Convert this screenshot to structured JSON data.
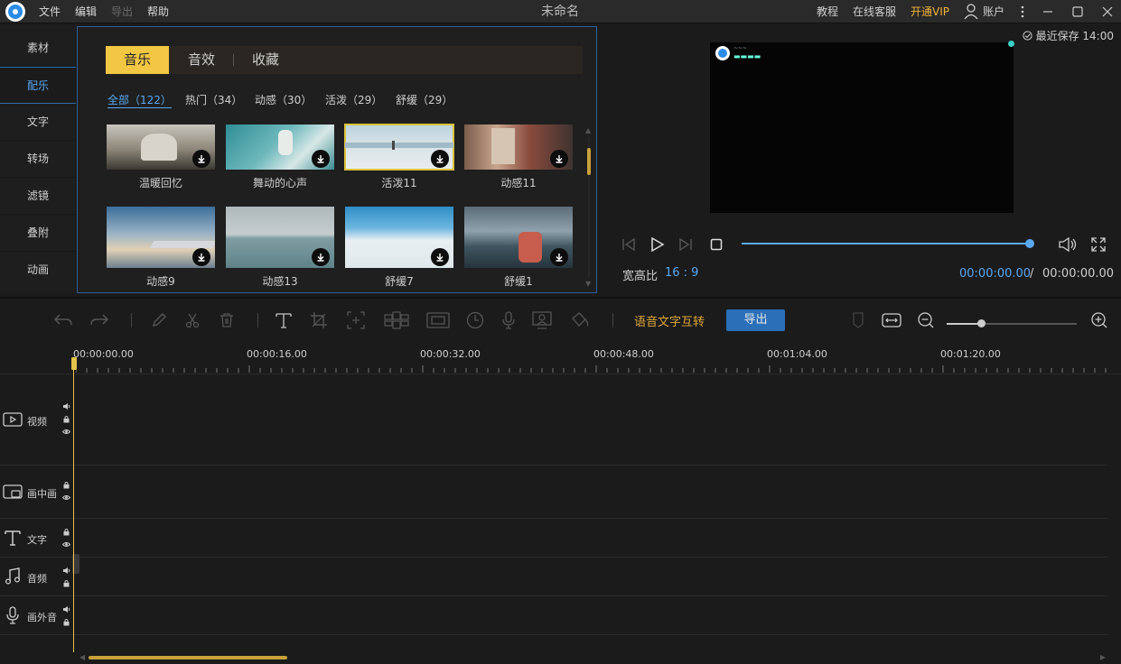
{
  "title_bar": {
    "menus": [
      "文件",
      "编辑",
      "导出",
      "帮助"
    ],
    "window_title": "未命名",
    "right_links": {
      "tutorial": "教程",
      "support": "在线客服",
      "vip": "开通VIP",
      "account": "账户"
    }
  },
  "left_nav": {
    "items": [
      "素材",
      "配乐",
      "文字",
      "转场",
      "滤镜",
      "叠附",
      "动画"
    ],
    "active_index": 1
  },
  "library": {
    "tabs": [
      "音乐",
      "音效",
      "收藏"
    ],
    "active_tab": 0,
    "filters": [
      "全部（122）",
      "热门（34）",
      "动感（30）",
      "活泼（29）",
      "舒缓（29）"
    ],
    "active_filter": 0,
    "cards": [
      {
        "label": "温暖回忆"
      },
      {
        "label": "舞动的心声"
      },
      {
        "label": "活泼11"
      },
      {
        "label": "动感11"
      },
      {
        "label": "动感9"
      },
      {
        "label": "动感13"
      },
      {
        "label": "舒缓7"
      },
      {
        "label": "舒缓1"
      }
    ]
  },
  "preview": {
    "autosave": "最近保存 14:00",
    "aspect_label": "宽高比",
    "aspect_value": "16 : 9",
    "time_current": "00:00:00.00",
    "time_separator": "/",
    "time_total": "00:00:00.00",
    "progress": 1.0
  },
  "toolbar": {
    "speech_convert": "语音文字互转",
    "export": "导出",
    "zoom_level": 0.27
  },
  "timeline": {
    "ruler_labels": [
      "00:00:00.00",
      "00:00:16.00",
      "00:00:32.00",
      "00:00:48.00",
      "00:01:04.00",
      "00:01:20.00"
    ],
    "tracks": [
      "视频",
      "画中画",
      "文字",
      "音频",
      "画外音"
    ]
  },
  "colors": {
    "accent_blue": "#5aa8f0",
    "accent_yellow": "#f2c744",
    "vip_orange": "#f2b33a",
    "export_blue": "#2a6fb8"
  }
}
